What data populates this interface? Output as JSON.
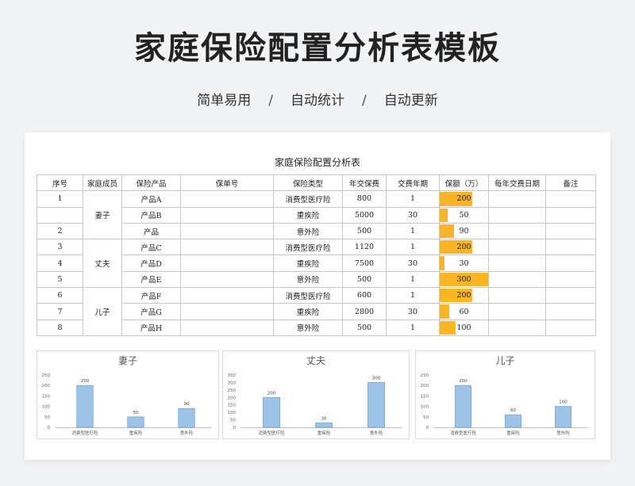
{
  "header": {
    "title": "家庭保险配置分析表模板",
    "features": [
      "简单易用",
      "自动统计",
      "自动更新"
    ],
    "separator": "/"
  },
  "table": {
    "title": "家庭保险配置分析表",
    "columns": [
      "序号",
      "家庭成员",
      "保险产品",
      "保单号",
      "保险类型",
      "年交保费",
      "交费年期",
      "保额（万）",
      "每年交费日期",
      "备注"
    ],
    "members": [
      "妻子",
      "丈夫",
      "儿子"
    ],
    "rows": [
      {
        "no": "1",
        "product": "产品A",
        "type": "消费型医疗险",
        "premium": "800",
        "years": "1",
        "amount": 200
      },
      {
        "no": "",
        "product": "产品B",
        "type": "重疾险",
        "premium": "5000",
        "years": "30",
        "amount": 50
      },
      {
        "no": "2",
        "product": "产品",
        "type": "意外险",
        "premium": "500",
        "years": "1",
        "amount": 90
      },
      {
        "no": "3",
        "product": "产品C",
        "type": "消费型医疗险",
        "premium": "1120",
        "years": "1",
        "amount": 200
      },
      {
        "no": "4",
        "product": "产品D",
        "type": "重疾险",
        "premium": "7500",
        "years": "30",
        "amount": 30
      },
      {
        "no": "5",
        "product": "产品E",
        "type": "意外险",
        "premium": "500",
        "years": "1",
        "amount": 300
      },
      {
        "no": "6",
        "product": "产品F",
        "type": "消费型医疗险",
        "premium": "600",
        "years": "1",
        "amount": 200
      },
      {
        "no": "7",
        "product": "产品G",
        "type": "重疾险",
        "premium": "2800",
        "years": "30",
        "amount": 60
      },
      {
        "no": "8",
        "product": "产品H",
        "type": "意外险",
        "premium": "500",
        "years": "1",
        "amount": 100
      }
    ],
    "bar_color": "#f9b523"
  },
  "chart_data": [
    {
      "type": "bar",
      "title": "妻子",
      "categories": [
        "消费型医疗险",
        "重疾险",
        "意外险"
      ],
      "values": [
        200,
        50,
        90
      ],
      "ylim": [
        0,
        250
      ],
      "yticks": [
        0,
        50,
        100,
        150,
        200,
        250
      ],
      "color": "#9dc3e6"
    },
    {
      "type": "bar",
      "title": "丈夫",
      "categories": [
        "消费型医疗险",
        "重疾险",
        "意外险"
      ],
      "values": [
        200,
        30,
        300
      ],
      "ylim": [
        0,
        350
      ],
      "yticks": [
        0,
        50,
        100,
        150,
        200,
        250,
        300,
        350
      ],
      "color": "#9dc3e6"
    },
    {
      "type": "bar",
      "title": "儿子",
      "categories": [
        "消费型医疗险",
        "重疾险",
        "意外险"
      ],
      "values": [
        200,
        60,
        100
      ],
      "ylim": [
        0,
        250
      ],
      "yticks": [
        0,
        50,
        100,
        150,
        200,
        250
      ],
      "color": "#9dc3e6"
    }
  ]
}
